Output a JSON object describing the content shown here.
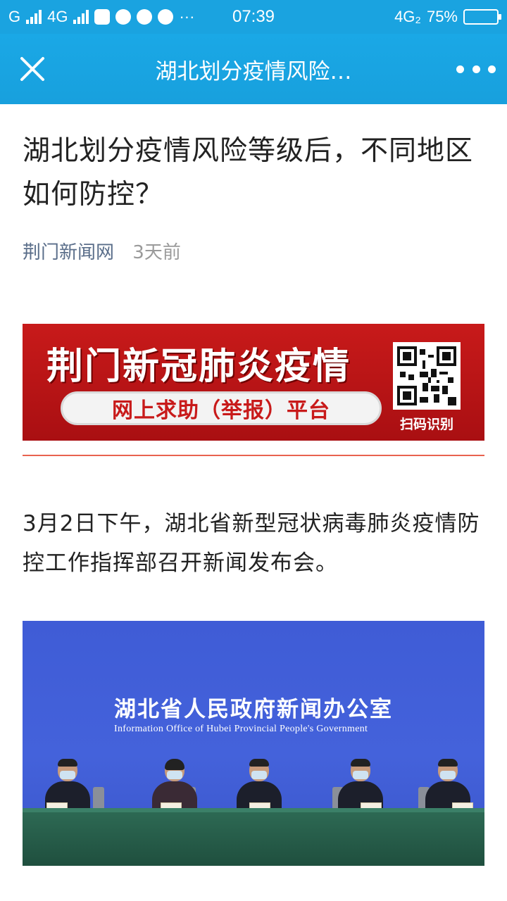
{
  "status_bar": {
    "carrier_left": "G",
    "network_type": "4G",
    "time": "07:39",
    "dots": "···",
    "network_right": "4G₂",
    "battery": "75%"
  },
  "header": {
    "title": "湖北划分疫情风险…",
    "close_icon": "close-icon",
    "more_icon": "more-icon"
  },
  "article": {
    "title": "湖北划分疫情风险等级后，不同地区如何防控？",
    "source": "荆门新闻网",
    "time_ago": "3天前",
    "banner": {
      "headline": "荆门新冠肺炎疫情",
      "pill_text": "网上求助（举报）平台",
      "scan_label": "扫码识别"
    },
    "paragraph": "3月2日下午，湖北省新型冠状病毒肺炎疫情防控工作指挥部召开新闻发布会。",
    "photo": {
      "org_cn": "湖北省人民政府新闻办公室",
      "org_en": "Information Office of Hubei Provincial People's Government"
    }
  },
  "colors": {
    "header_bg": "#1aa3e0",
    "banner_red": "#c81a1a",
    "divider": "#e8624f",
    "source_text": "#5a6e8a"
  }
}
